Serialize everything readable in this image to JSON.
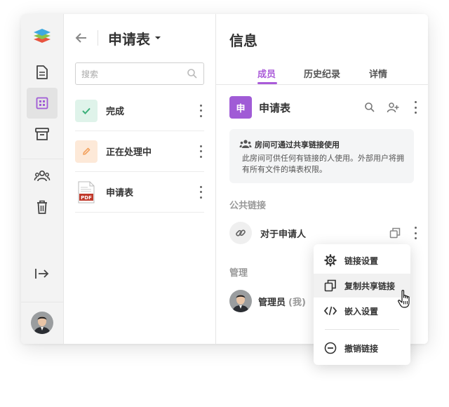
{
  "list_panel": {
    "title": "申请表",
    "search_placeholder": "搜索",
    "items": [
      {
        "label": "完成",
        "icon": "check-icon"
      },
      {
        "label": "正在处理中",
        "icon": "pencil-icon"
      },
      {
        "label": "申请表",
        "icon": "pdf-file-icon",
        "file_tag": "PDF"
      }
    ]
  },
  "info_panel": {
    "title": "信息",
    "tabs": [
      {
        "label": "成员",
        "active": true
      },
      {
        "label": "历史纪录",
        "active": false
      },
      {
        "label": "详情",
        "active": false
      }
    ],
    "room": {
      "badge": "申",
      "name": "申请表"
    },
    "notice": {
      "title": "房间可通过共享链接使用",
      "body": "此房间可供任何有链接的人使用。外部用户将拥有所有文件的填表权限。"
    },
    "public_links_header": "公共链接",
    "link_name": "对于申请人",
    "admin_header": "管理",
    "member": {
      "name": "管理员",
      "me_tag": "(我)"
    }
  },
  "context_menu": {
    "items": [
      {
        "label": "链接设置",
        "icon": "gear-icon"
      },
      {
        "label": "复制共享链接",
        "icon": "copy-icon",
        "hovered": true
      },
      {
        "label": "嵌入设置",
        "icon": "code-icon"
      },
      {
        "label": "撤销链接",
        "icon": "minus-circle-icon"
      }
    ]
  },
  "colors": {
    "accent": "#aa5bd9",
    "room_badge": "#a05bd6",
    "done_bg": "#dff3ea",
    "done_icon": "#3bb07a",
    "inprogress_bg": "#fde9d8",
    "inprogress_icon": "#f3a25e",
    "pdf_red": "#c0392b"
  }
}
